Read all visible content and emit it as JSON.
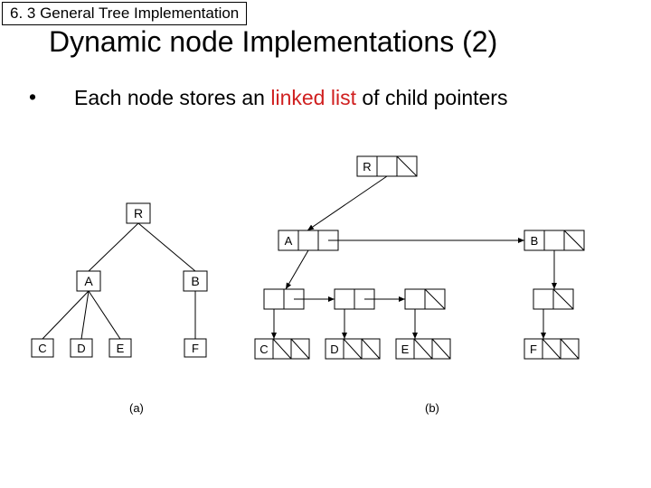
{
  "breadcrumb": "6. 3 General Tree Implementation",
  "title": "Dynamic node Implementations (2)",
  "bullet": {
    "prefix": "Each node stores an ",
    "highlight": "linked list",
    "suffix": " of child pointers"
  },
  "captions": {
    "a": "(a)",
    "b": "(b)"
  },
  "treeA": {
    "root": "R",
    "level1": [
      "A",
      "B"
    ],
    "level2_A": [
      "C",
      "D",
      "E"
    ],
    "level2_B": [
      "F"
    ]
  },
  "diagramB": {
    "root": "R",
    "level1": [
      "A",
      "B"
    ],
    "level2": [
      "C",
      "D",
      "E",
      "F"
    ]
  }
}
